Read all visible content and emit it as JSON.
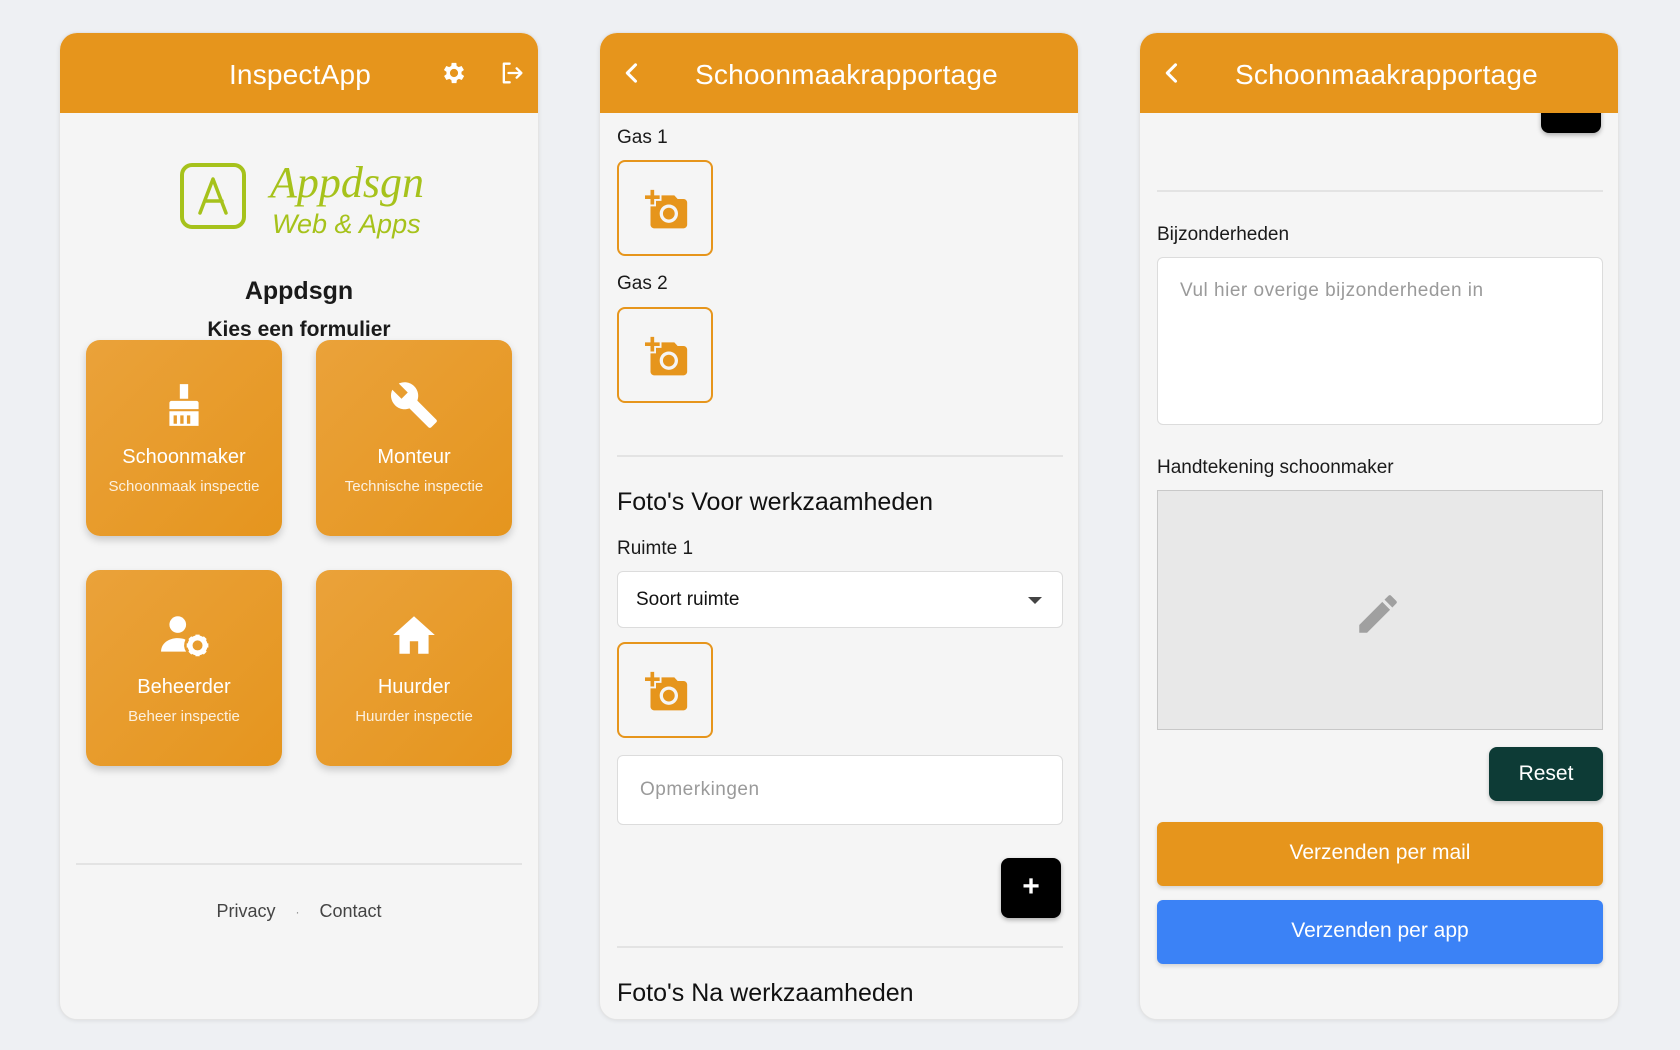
{
  "colors": {
    "primary": "#e6951c",
    "background": "#f5f5f5",
    "reset": "#0d3b36",
    "app_button": "#3b82f6",
    "logo_green": "#a6c21b"
  },
  "home": {
    "appbar_title": "InspectApp",
    "logo_text": "Appdsgn",
    "logo_tagline": "Web & Apps",
    "company": "Appdsgn",
    "subtitle": "Kies een formulier",
    "tiles": [
      {
        "label": "Schoonmaker",
        "desc": "Schoonmaak inspectie",
        "icon": "broom-icon"
      },
      {
        "label": "Monteur",
        "desc": "Technische inspectie",
        "icon": "wrench-icon"
      },
      {
        "label": "Beheerder",
        "desc": "Beheer inspectie",
        "icon": "admin-user-icon"
      },
      {
        "label": "Huurder",
        "desc": "Huurder inspectie",
        "icon": "home-icon"
      }
    ],
    "footer": {
      "privacy": "Privacy",
      "separator": "·",
      "contact": "Contact"
    }
  },
  "form": {
    "appbar_title": "Schoonmaakrapportage",
    "gas1": "Gas 1",
    "gas2": "Gas 2",
    "section_before": "Foto's Voor werkzaamheden",
    "room_label": "Ruimte 1",
    "room_select": "Soort ruimte",
    "remarks_placeholder": "Opmerkingen",
    "add_label": "+",
    "section_after": "Foto's Na werkzaamheden"
  },
  "submit": {
    "appbar_title": "Schoonmaakrapportage",
    "add_label": "+",
    "details_label": "Bijzonderheden",
    "details_placeholder": "Vul hier overige bijzonderheden in",
    "signature_label": "Handtekening schoonmaker",
    "reset_label": "Reset",
    "send_mail_label": "Verzenden per mail",
    "send_app_label": "Verzenden per app"
  }
}
